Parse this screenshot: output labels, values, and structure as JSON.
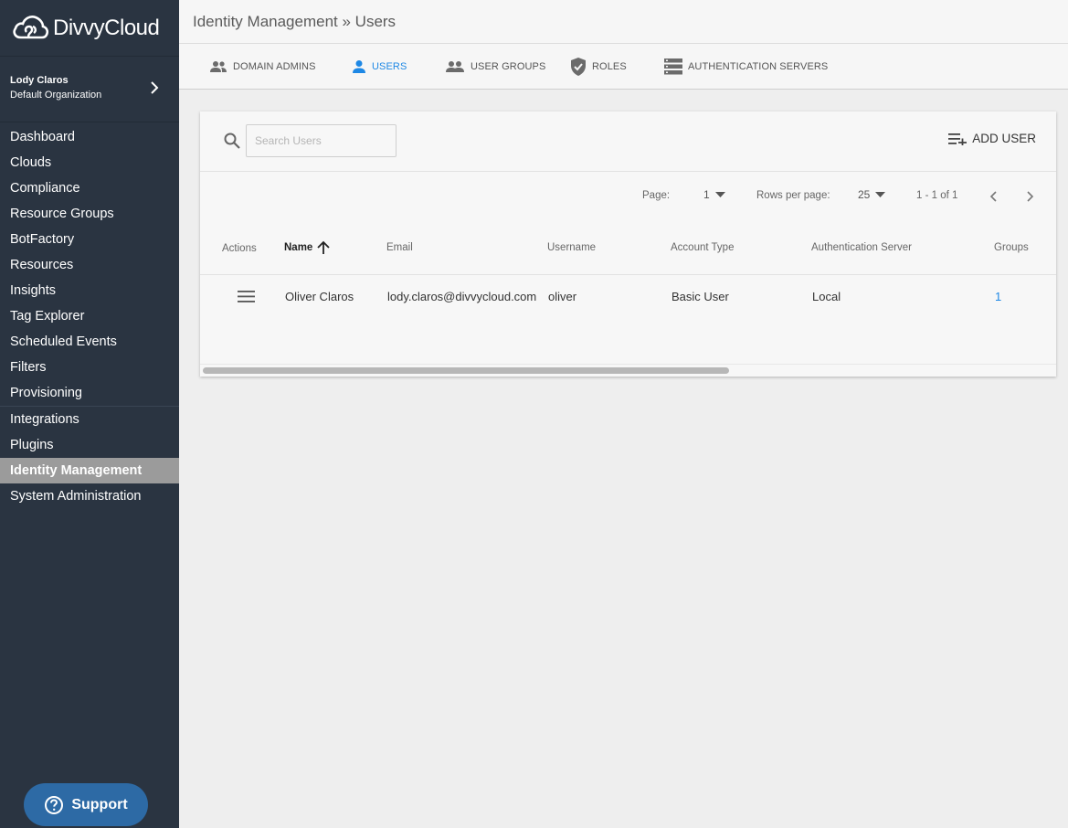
{
  "sidebar": {
    "logo_text": "DivvyCloud",
    "user": {
      "name": "Lody Claros",
      "org": "Default Organization"
    },
    "nav": [
      "Dashboard",
      "Clouds",
      "Compliance",
      "Resource Groups",
      "BotFactory",
      "Resources",
      "Insights",
      "Tag Explorer",
      "Scheduled Events",
      "Filters",
      "Provisioning",
      "Integrations",
      "Plugins",
      "Identity Management",
      "System Administration"
    ],
    "active_item": "Identity Management",
    "support_label": "Support"
  },
  "header": {
    "title": "Identity Management » Users"
  },
  "tabs": [
    {
      "label": "DOMAIN ADMINS",
      "icon": "people-icon",
      "active": false
    },
    {
      "label": "USERS",
      "icon": "person-icon",
      "active": true
    },
    {
      "label": "USER GROUPS",
      "icon": "group-icon",
      "active": false
    },
    {
      "label": "ROLES",
      "icon": "shield-icon",
      "active": false
    },
    {
      "label": "AUTHENTICATION SERVERS",
      "icon": "servers-icon",
      "active": false
    }
  ],
  "toolbar": {
    "search_placeholder": "Search Users",
    "add_user_label": "ADD USER"
  },
  "pagination": {
    "page_label": "Page:",
    "page_value": "1",
    "rows_label": "Rows per page:",
    "rows_value": "25",
    "range": "1 - 1 of 1"
  },
  "table": {
    "columns": [
      "Actions",
      "Name",
      "Email",
      "Username",
      "Account Type",
      "Authentication Server",
      "Groups"
    ],
    "sort_column": "Name",
    "rows": [
      {
        "name": "Oliver Claros",
        "email": "lody.claros@divvycloud.com",
        "username": "oliver",
        "account_type": "Basic User",
        "auth_server": "Local",
        "groups": "1"
      }
    ]
  },
  "colors": {
    "sidebar_bg": "#2a3441",
    "accent": "#1e88e5",
    "support_bg": "#2d6aa5",
    "active_nav_bg": "#9b9b9b"
  }
}
